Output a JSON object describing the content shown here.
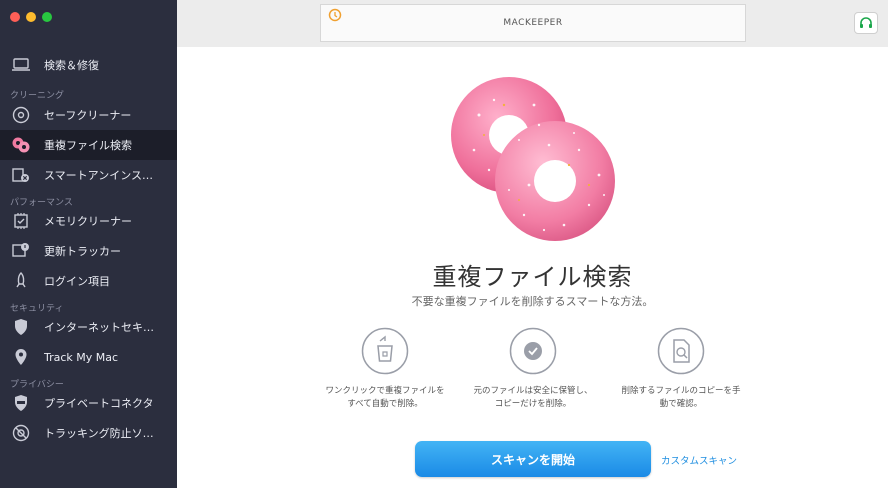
{
  "window": {
    "controls": [
      "close",
      "minimize",
      "zoom"
    ]
  },
  "sidebar": {
    "sections": {
      "cleaning": "クリーニング",
      "performance": "パフォーマンス",
      "security": "セキュリティ",
      "privacy": "プライバシー"
    },
    "items": [
      {
        "label": "検索＆修復",
        "icon": "laptop-icon"
      },
      {
        "label": "セーフクリーナー",
        "icon": "disc-icon"
      },
      {
        "label": "重複ファイル検索",
        "icon": "donuts-icon",
        "active": true
      },
      {
        "label": "スマートアンインス…",
        "icon": "uninstall-icon"
      },
      {
        "label": "メモリクリーナー",
        "icon": "memory-chip-icon"
      },
      {
        "label": "更新トラッカー",
        "icon": "update-tracker-icon"
      },
      {
        "label": "ログイン項目",
        "icon": "rocket-icon"
      },
      {
        "label": "インターネットセキュ…",
        "icon": "shield-icon"
      },
      {
        "label": "Track My Mac",
        "icon": "location-pin-icon"
      },
      {
        "label": "プライベートコネクタ",
        "icon": "vpn-shield-icon"
      },
      {
        "label": "トラッキング防止ソフト",
        "icon": "no-tracking-icon"
      }
    ]
  },
  "topbar": {
    "title": "MACKEEPER",
    "history_icon": "history-icon",
    "support_icon": "headset-icon"
  },
  "main": {
    "heading": "重複ファイル検索",
    "subheading": "不要な重複ファイルを削除するスマートな方法。",
    "features": [
      {
        "icon": "trash-arrow-icon",
        "text": "ワンクリックで重複ファイルを\nすべて自動で削除。"
      },
      {
        "icon": "checkmark-icon",
        "text": "元のファイルは安全に保管し、\nコピーだけを削除。"
      },
      {
        "icon": "file-search-icon",
        "text": "削除するファイルのコピーを手\n動で確認。"
      }
    ],
    "scan_button": "スキャンを開始",
    "custom_scan": "カスタムスキャン"
  },
  "colors": {
    "sidebar_bg": "#2b2e3e",
    "accent": "#1f8ee0",
    "donut_pink": "#f07aa0"
  }
}
